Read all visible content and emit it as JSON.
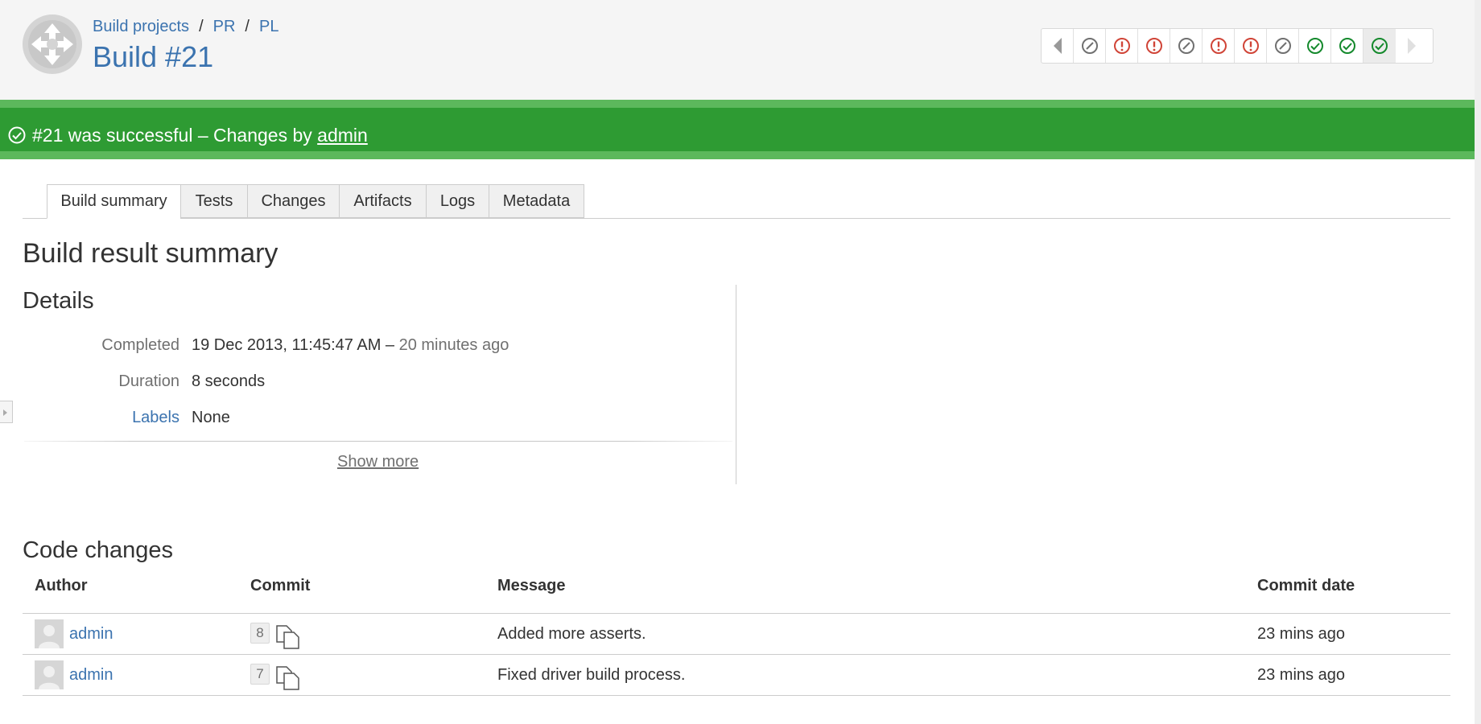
{
  "breadcrumb": {
    "items": [
      "Build projects",
      "PR",
      "PL"
    ],
    "separator": "/"
  },
  "page_title": "Build #21",
  "build_history": {
    "statuses": [
      "not-built",
      "failed",
      "failed",
      "not-built",
      "failed",
      "failed",
      "not-built",
      "success",
      "success",
      "success"
    ],
    "current_index": 9
  },
  "status_bar": {
    "text": "#21 was successful – Changes by",
    "author_link": "admin",
    "color": "#2e9b33"
  },
  "tabs": [
    "Build summary",
    "Tests",
    "Changes",
    "Artifacts",
    "Logs",
    "Metadata"
  ],
  "active_tab": "Build summary",
  "summary": {
    "heading": "Build result summary",
    "details_heading": "Details",
    "completed_label": "Completed",
    "completed_value": "19 Dec 2013, 11:45:47 AM –",
    "completed_relative": "20 minutes ago",
    "duration_label": "Duration",
    "duration_value": "8 seconds",
    "labels_label": "Labels",
    "labels_value": "None",
    "show_more": "Show more"
  },
  "code_changes": {
    "heading": "Code changes",
    "columns": [
      "Author",
      "Commit",
      "Message",
      "Commit date"
    ],
    "rows": [
      {
        "author": "admin",
        "commit": "8",
        "message": "Added more asserts.",
        "date": "23 mins ago"
      },
      {
        "author": "admin",
        "commit": "7",
        "message": "Fixed driver build process.",
        "date": "23 mins ago"
      }
    ]
  },
  "colors": {
    "link": "#3b73af",
    "success": "#14892c",
    "failed": "#d04437",
    "not_built": "#707070"
  }
}
